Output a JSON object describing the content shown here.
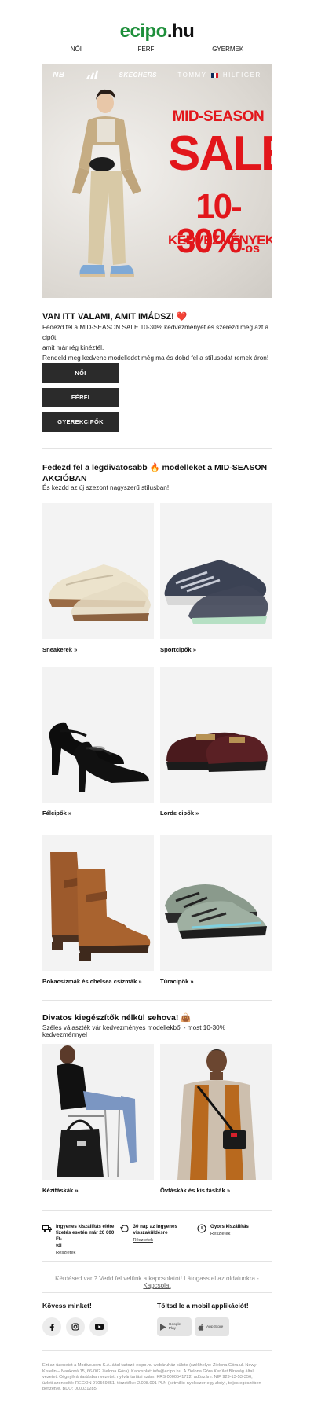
{
  "logo": {
    "ecipo": "ecipo",
    "hu": ".hu"
  },
  "nav": {
    "items": [
      "NŐI",
      "FÉRFI",
      "GYERMEK"
    ]
  },
  "hero": {
    "brands": [
      "NB",
      "adidas",
      "SKECHERS",
      "TOMMY",
      "HILFIGER"
    ],
    "line1": "MID-SEASON",
    "line2": "SALE",
    "line3": "10-30%",
    "line3_suffix": "-os",
    "line4": "KEDVEZMÉNYEK"
  },
  "intro": {
    "title": "VAN ITT VALAMI, AMIT IMÁDSZ! ❤️",
    "line1": "Fedezd fel a MID-SEASON SALE 10-30% kedvezményét és szerezd meg azt a cipőt,",
    "line2": "amit már rég kinéztél.",
    "line3": "Rendeld meg kedvenc modelledet még ma és dobd fel a stílusodat remek áron!"
  },
  "buttons": {
    "women": "NŐI",
    "men": "FÉRFI",
    "kids": "GYEREKCIPŐK"
  },
  "shoes": {
    "title_line1": "Fedezd fel a legdivatosabb 🔥 modelleket a MID-SEASON",
    "title_line2": "AKCIÓBAN",
    "subtitle": "És kezdd az új szezont nagyszerű stílusban!",
    "tiles": [
      {
        "label": "Sneakerek »"
      },
      {
        "label": "Sportcipők »"
      },
      {
        "label": "Félcipők »"
      },
      {
        "label": "Lords cipők »"
      },
      {
        "label": "Bokacsizmák és chelsea csizmák »"
      },
      {
        "label": "Túracipők »"
      }
    ]
  },
  "accessories": {
    "title": "Divatos kiegészítők nélkül sehova! 👜",
    "subtitle": "Széles választék vár kedvezményes modellekből - most 10-30% kedvezménnyel",
    "tiles": [
      {
        "label": "Kézitáskák »"
      },
      {
        "label": "Övtáskák és kis táskák »"
      }
    ]
  },
  "benefits": [
    {
      "icon": "truck-icon",
      "text_line1": "Ingyenes kiszállítás előre",
      "text_line2": "fizetés esetén már 20 000 Ft-",
      "text_line3": "tól",
      "link": "Részletek"
    },
    {
      "icon": "return-icon",
      "text_line1": "30 nap az ingyenes",
      "text_line2": "visszaküldésre",
      "text_line3": "",
      "link": "Részletek"
    },
    {
      "icon": "clock-icon",
      "text_line1": "Gyors kiszállítás",
      "text_line2": "",
      "text_line3": "",
      "link": "Részletek"
    }
  ],
  "contact": {
    "question": "Kérdésed van? Vedd fel velünk a kapcsolatot! Látogass el az oldalunkra - ",
    "link": "Kapcsolat"
  },
  "follow": {
    "title": "Kövess minket!"
  },
  "app": {
    "title": "Töltsd le a mobil applikációt!",
    "google": "Google Play",
    "apple": "App Store"
  },
  "legal": {
    "line1": "Ezt az üzenetet a Modivo.com S.A. által tartozó ecipo.hu webáruház küldte (székhelye: Zielona Góra ul. Nowy",
    "line2": "Kisielin – Nauková 15, 66-002 Zielona Góra). Kapcsolat: info@ecipo.hu. A Zielona Góra Kerület Bíróság által",
    "line3": "vezetett Cégnyilvántartásban vezetett nyilvántartási szám: KRS 0000541722, adószám: NIP 929-13-53-356,",
    "line4": "üzleti azonosító: REGON 970569851, törzstőke: 2.008.001 PLN (kétmillió-nyolcezer-egy złoty), teljes egészében",
    "line5": "befizetve. BDO: 000031285."
  }
}
